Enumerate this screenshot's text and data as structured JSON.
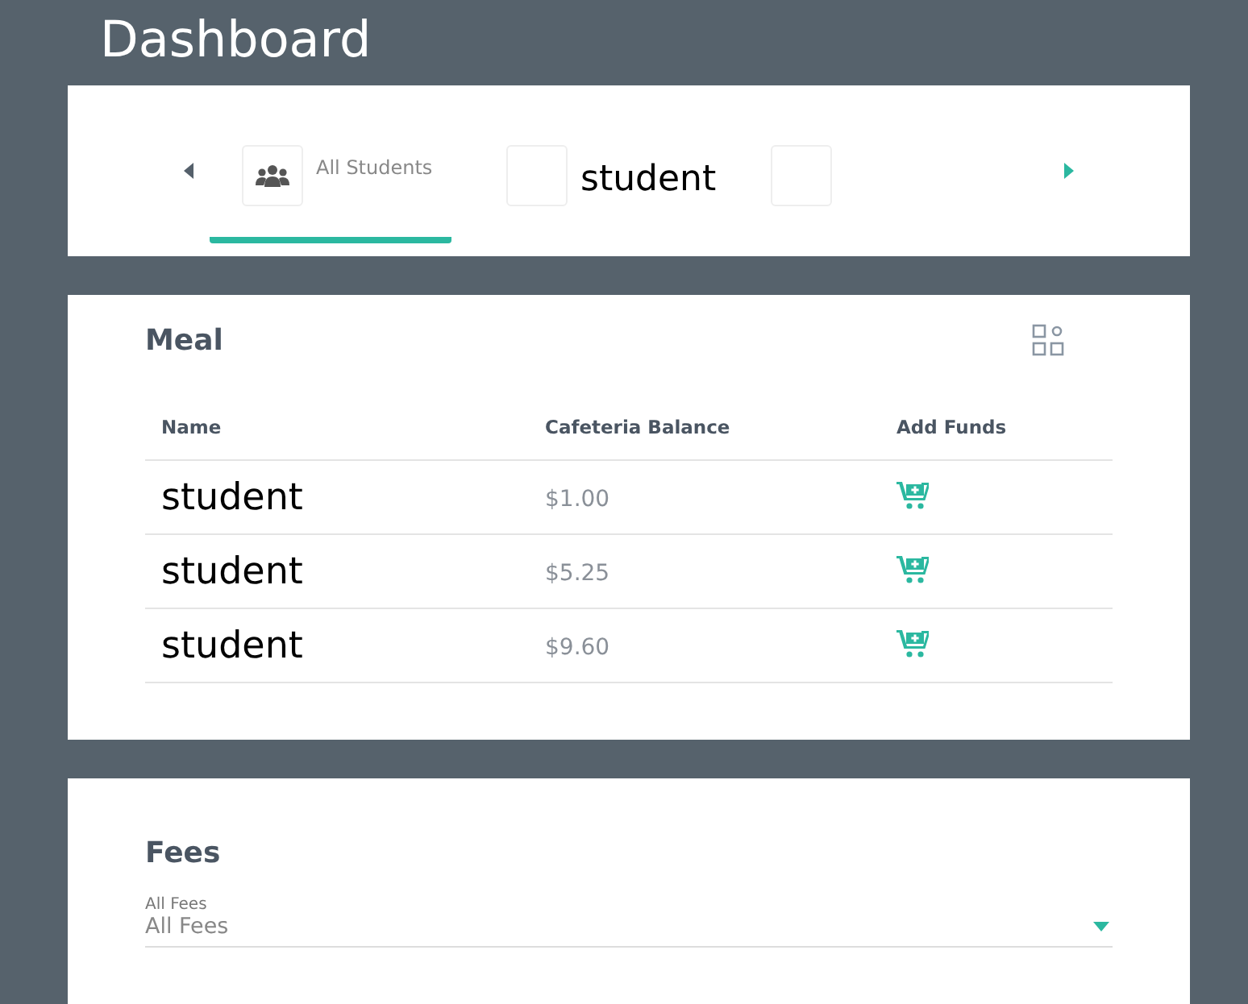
{
  "page_title": "Dashboard",
  "student_tabs": [
    {
      "label": "All Students",
      "selected": true,
      "kind": "group"
    },
    {
      "label": "student",
      "selected": false,
      "kind": "student"
    },
    {
      "selected": false,
      "kind": "student"
    }
  ],
  "meal": {
    "title": "Meal",
    "columns": [
      "Name",
      "Cafeteria Balance",
      "Add Funds"
    ],
    "rows": [
      {
        "name": "student",
        "balance": "$1.00"
      },
      {
        "name": "student",
        "balance": "$5.25"
      },
      {
        "name": "student",
        "balance": "$9.60"
      }
    ]
  },
  "fees": {
    "title": "Fees",
    "select": {
      "label": "All Fees",
      "value": "All Fees"
    }
  }
}
